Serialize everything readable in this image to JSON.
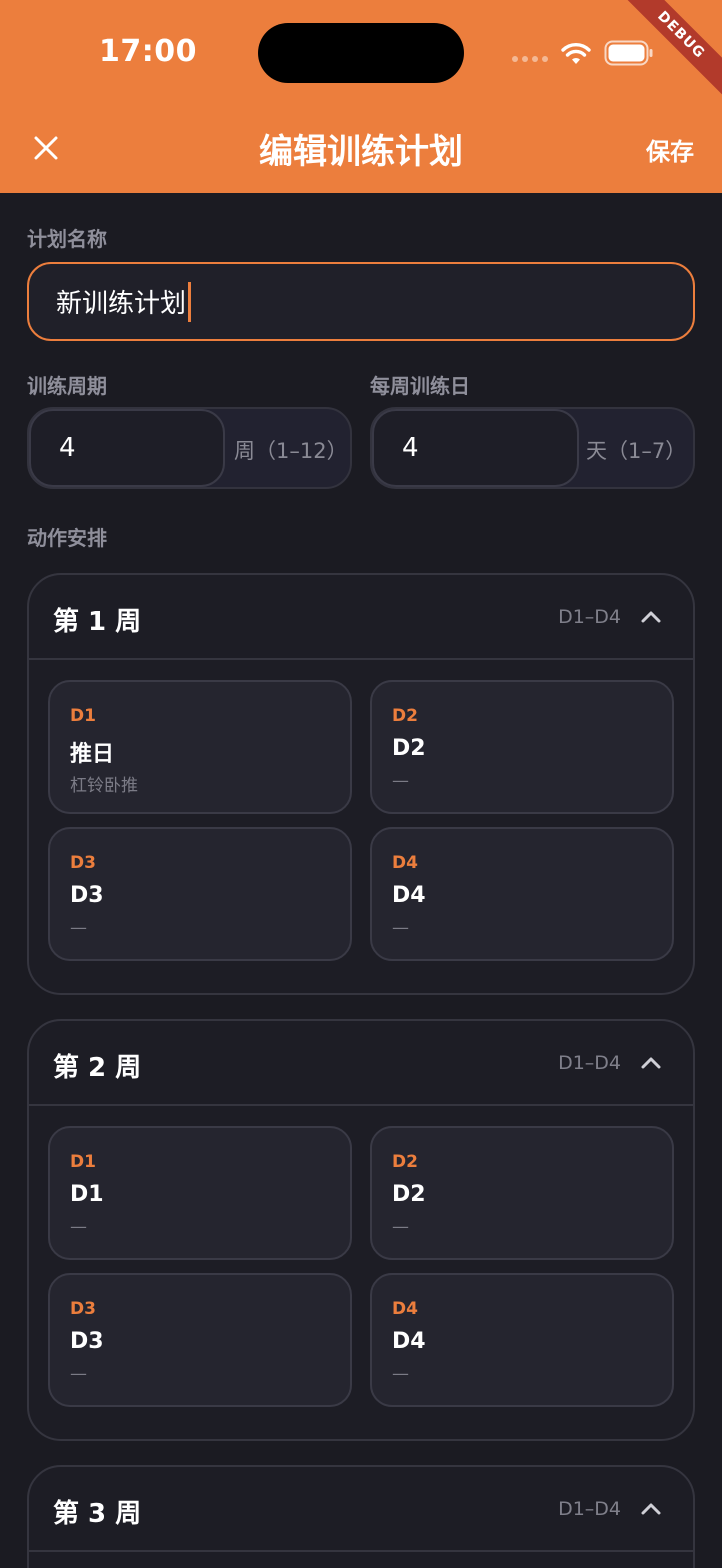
{
  "status_bar": {
    "time": "17:00",
    "debug": "DEBUG"
  },
  "header": {
    "title": "编辑训练计划",
    "save_label": "保存"
  },
  "form": {
    "name_label": "计划名称",
    "name_value": "新训练计划",
    "period_label": "训练周期",
    "period_value": "4",
    "period_suffix": "周（1–12）",
    "days_label": "每周训练日",
    "days_value": "4",
    "days_suffix": "天（1–7）",
    "schedule_label": "动作安排"
  },
  "weeks": [
    {
      "title": "第 1 周",
      "range": "D1–D4",
      "days": [
        {
          "tag": "D1",
          "name": "推日",
          "exercise": "杠铃卧推"
        },
        {
          "tag": "D2",
          "name": "D2",
          "exercise": "—"
        },
        {
          "tag": "D3",
          "name": "D3",
          "exercise": "—"
        },
        {
          "tag": "D4",
          "name": "D4",
          "exercise": "—"
        }
      ]
    },
    {
      "title": "第 2 周",
      "range": "D1–D4",
      "days": [
        {
          "tag": "D1",
          "name": "D1",
          "exercise": "—"
        },
        {
          "tag": "D2",
          "name": "D2",
          "exercise": "—"
        },
        {
          "tag": "D3",
          "name": "D3",
          "exercise": "—"
        },
        {
          "tag": "D4",
          "name": "D4",
          "exercise": "—"
        }
      ]
    },
    {
      "title": "第 3 周",
      "range": "D1–D4",
      "days": []
    }
  ],
  "colors": {
    "accent": "#ec7e3d",
    "background": "#1b1b22",
    "card": "#25252f"
  }
}
